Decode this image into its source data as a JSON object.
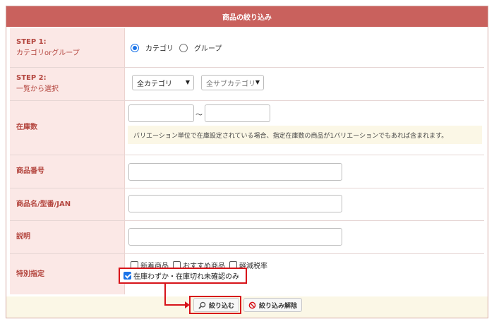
{
  "header": {
    "title": "商品の絞り込み"
  },
  "rows": {
    "step1": {
      "label": "STEP 1:",
      "sublabel": "カテゴリorグループ",
      "options": [
        "カテゴリ",
        "グループ"
      ],
      "selected": "カテゴリ"
    },
    "step2": {
      "label": "STEP 2:",
      "sublabel": "一覧から選択",
      "category_select": "全カテゴリ",
      "subcategory_select": "全サブカテゴリ"
    },
    "stock": {
      "label": "在庫数",
      "range_separator": "〜",
      "min_value": "",
      "max_value": "",
      "note": "バリエーション単位で在庫設定されている場合、指定在庫数の商品が1バリエーションでもあれば含まれます。"
    },
    "product_number": {
      "label": "商品番号",
      "value": ""
    },
    "product_name": {
      "label": "商品名/型番/JAN",
      "value": ""
    },
    "description": {
      "label": "説明",
      "value": ""
    },
    "special": {
      "label": "特別指定",
      "checkboxes": [
        {
          "label": "新着商品",
          "checked": false
        },
        {
          "label": "おすすめ商品",
          "checked": false
        },
        {
          "label": "軽減税率",
          "checked": false
        }
      ],
      "low_stock": {
        "label": "在庫わずか・在庫切れ未確認のみ",
        "checked": true
      }
    }
  },
  "footer": {
    "filter_button": "絞り込む",
    "clear_button": "絞り込み解除"
  },
  "colors": {
    "header_bg": "#c9615d",
    "label_bg": "#fbe8e6",
    "label_text": "#b4463f",
    "highlight": "#d7141a",
    "checkbox_checked": "#1a73e8"
  }
}
